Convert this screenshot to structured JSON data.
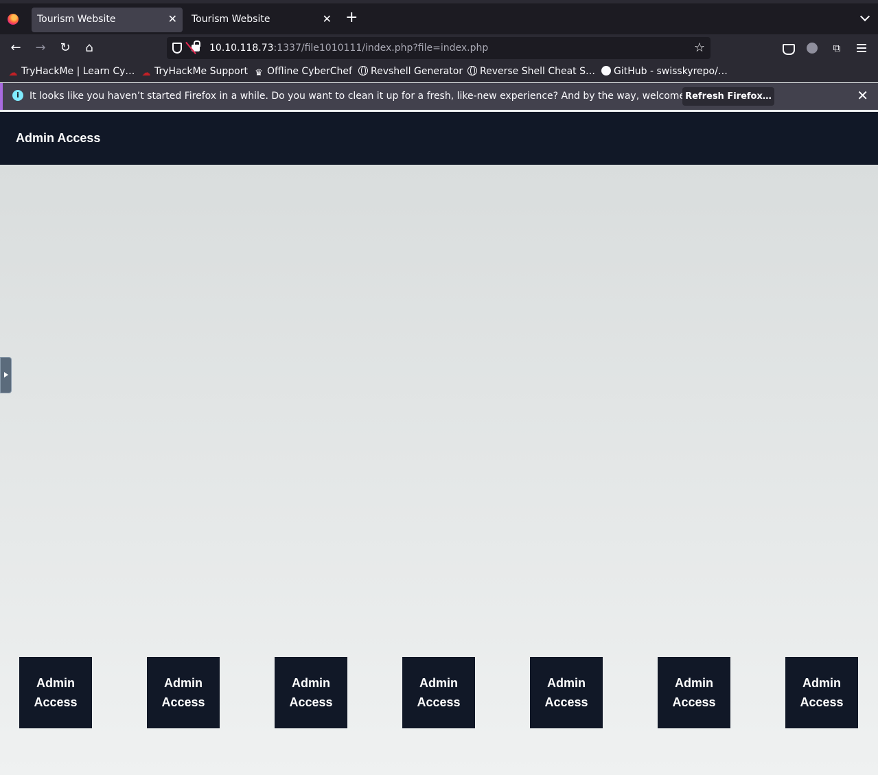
{
  "browser": {
    "tabs": [
      {
        "title": "Tourism Website",
        "active": true
      },
      {
        "title": "Tourism Website",
        "active": false
      }
    ],
    "url": {
      "host": "10.10.118.73",
      "rest": ":1337/file1010111/index.php?file=index.php"
    },
    "bookmarks": [
      {
        "label": "TryHackMe | Learn Cy…",
        "icon": "tryhackme-icon"
      },
      {
        "label": "TryHackMe Support",
        "icon": "tryhackme-icon"
      },
      {
        "label": "Offline CyberChef",
        "icon": "chef-hat-icon"
      },
      {
        "label": "Revshell Generator",
        "icon": "globe-icon"
      },
      {
        "label": "Reverse Shell Cheat S…",
        "icon": "globe-icon"
      },
      {
        "label": "GitHub - swisskyrepo/…",
        "icon": "github-icon"
      }
    ],
    "notification": {
      "text": "It looks like you haven’t started Firefox in a while. Do you want to clean it up for a fresh, like-new experience? And by the way, welcome back!",
      "button": "Refresh Firefox…"
    }
  },
  "page": {
    "header_title": "Admin Access",
    "cards": [
      "Admin Access",
      "Admin Access",
      "Admin Access",
      "Admin Access",
      "Admin Access",
      "Admin Access",
      "Admin Access"
    ]
  },
  "colors": {
    "header_bg": "#111827",
    "card_bg": "#111827",
    "notice_accent": "#a86be0"
  }
}
